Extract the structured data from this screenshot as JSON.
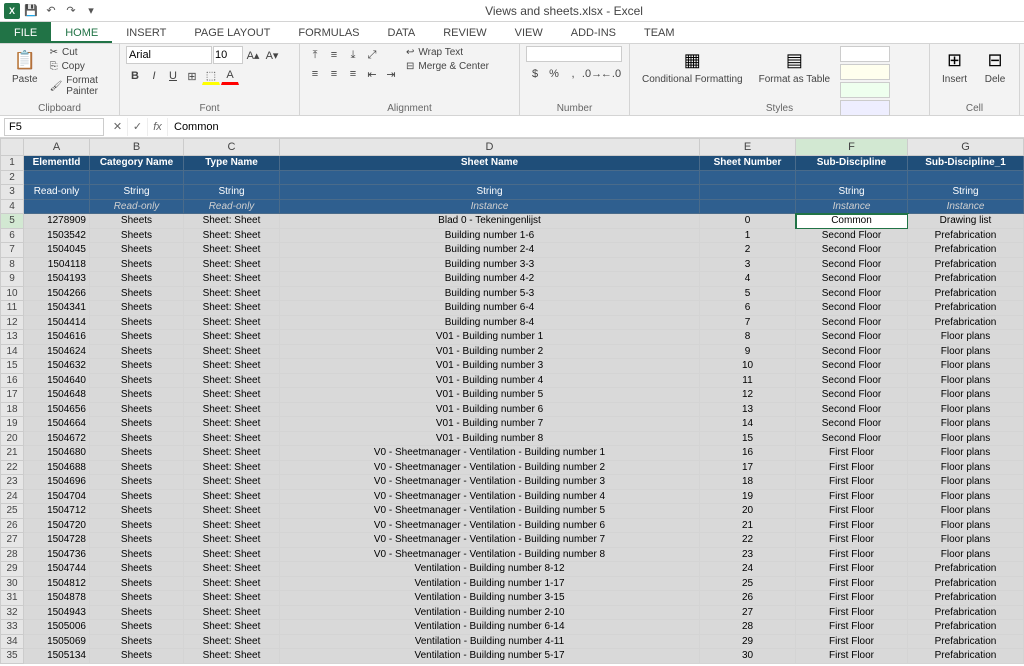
{
  "title": "Views and sheets.xlsx - Excel",
  "tabs": [
    "FILE",
    "HOME",
    "INSERT",
    "PAGE LAYOUT",
    "FORMULAS",
    "DATA",
    "REVIEW",
    "VIEW",
    "ADD-INS",
    "TEAM"
  ],
  "ribbon": {
    "clipboard": {
      "paste": "Paste",
      "cut": "Cut",
      "copy": "Copy",
      "fmt": "Format Painter",
      "label": "Clipboard"
    },
    "font": {
      "name": "Arial",
      "size": "10",
      "label": "Font"
    },
    "alignment": {
      "wrap": "Wrap Text",
      "merge": "Merge & Center",
      "label": "Alignment"
    },
    "number": {
      "label": "Number"
    },
    "styles": {
      "cond": "Conditional Formatting",
      "table": "Format as Table",
      "label": "Styles"
    },
    "cells": {
      "insert": "Insert",
      "delete": "Dele",
      "label": "Cell"
    }
  },
  "namebox": "F5",
  "formula": "Common",
  "columns": [
    "A",
    "B",
    "C",
    "D",
    "E",
    "F",
    "G"
  ],
  "headers": {
    "r1": [
      "ElementId",
      "Category Name",
      "Type Name",
      "Sheet Name",
      "Sheet Number",
      "Sub-Discipline",
      "Sub-Discipline_1"
    ],
    "r2": [
      "Read-only",
      "String",
      "String",
      "String",
      "",
      "String",
      "String"
    ],
    "r3": [
      "",
      "Read-only",
      "Read-only",
      "Instance",
      "",
      "Instance",
      "Instance"
    ]
  },
  "rows": [
    {
      "n": 5,
      "d": [
        "1278909",
        "Sheets",
        "Sheet: Sheet",
        "Blad 0 - Tekeningenlijst",
        "0",
        "Common",
        "Drawing list"
      ]
    },
    {
      "n": 6,
      "d": [
        "1503542",
        "Sheets",
        "Sheet: Sheet",
        "Building number 1-6",
        "1",
        "Second Floor",
        "Prefabrication"
      ]
    },
    {
      "n": 7,
      "d": [
        "1504045",
        "Sheets",
        "Sheet: Sheet",
        "Building number 2-4",
        "2",
        "Second Floor",
        "Prefabrication"
      ]
    },
    {
      "n": 8,
      "d": [
        "1504118",
        "Sheets",
        "Sheet: Sheet",
        "Building number 3-3",
        "3",
        "Second Floor",
        "Prefabrication"
      ]
    },
    {
      "n": 9,
      "d": [
        "1504193",
        "Sheets",
        "Sheet: Sheet",
        "Building number 4-2",
        "4",
        "Second Floor",
        "Prefabrication"
      ]
    },
    {
      "n": 10,
      "d": [
        "1504266",
        "Sheets",
        "Sheet: Sheet",
        "Building number 5-3",
        "5",
        "Second Floor",
        "Prefabrication"
      ]
    },
    {
      "n": 11,
      "d": [
        "1504341",
        "Sheets",
        "Sheet: Sheet",
        "Building number 6-4",
        "6",
        "Second Floor",
        "Prefabrication"
      ]
    },
    {
      "n": 12,
      "d": [
        "1504414",
        "Sheets",
        "Sheet: Sheet",
        "Building number 8-4",
        "7",
        "Second Floor",
        "Prefabrication"
      ]
    },
    {
      "n": 13,
      "d": [
        "1504616",
        "Sheets",
        "Sheet: Sheet",
        "V01 - Building number 1",
        "8",
        "Second Floor",
        "Floor plans"
      ]
    },
    {
      "n": 14,
      "d": [
        "1504624",
        "Sheets",
        "Sheet: Sheet",
        "V01 - Building number 2",
        "9",
        "Second Floor",
        "Floor plans"
      ]
    },
    {
      "n": 15,
      "d": [
        "1504632",
        "Sheets",
        "Sheet: Sheet",
        "V01 - Building number 3",
        "10",
        "Second Floor",
        "Floor plans"
      ]
    },
    {
      "n": 16,
      "d": [
        "1504640",
        "Sheets",
        "Sheet: Sheet",
        "V01 - Building number 4",
        "11",
        "Second Floor",
        "Floor plans"
      ]
    },
    {
      "n": 17,
      "d": [
        "1504648",
        "Sheets",
        "Sheet: Sheet",
        "V01 - Building number 5",
        "12",
        "Second Floor",
        "Floor plans"
      ]
    },
    {
      "n": 18,
      "d": [
        "1504656",
        "Sheets",
        "Sheet: Sheet",
        "V01 - Building number 6",
        "13",
        "Second Floor",
        "Floor plans"
      ]
    },
    {
      "n": 19,
      "d": [
        "1504664",
        "Sheets",
        "Sheet: Sheet",
        "V01 - Building number 7",
        "14",
        "Second Floor",
        "Floor plans"
      ]
    },
    {
      "n": 20,
      "d": [
        "1504672",
        "Sheets",
        "Sheet: Sheet",
        "V01 - Building number 8",
        "15",
        "Second Floor",
        "Floor plans"
      ]
    },
    {
      "n": 21,
      "d": [
        "1504680",
        "Sheets",
        "Sheet: Sheet",
        "V0 - Sheetmanager - Ventilation - Building number 1",
        "16",
        "First Floor",
        "Floor plans"
      ]
    },
    {
      "n": 22,
      "d": [
        "1504688",
        "Sheets",
        "Sheet: Sheet",
        "V0 - Sheetmanager - Ventilation - Building number 2",
        "17",
        "First Floor",
        "Floor plans"
      ]
    },
    {
      "n": 23,
      "d": [
        "1504696",
        "Sheets",
        "Sheet: Sheet",
        "V0 - Sheetmanager - Ventilation - Building number 3",
        "18",
        "First Floor",
        "Floor plans"
      ]
    },
    {
      "n": 24,
      "d": [
        "1504704",
        "Sheets",
        "Sheet: Sheet",
        "V0 - Sheetmanager - Ventilation - Building number 4",
        "19",
        "First Floor",
        "Floor plans"
      ]
    },
    {
      "n": 25,
      "d": [
        "1504712",
        "Sheets",
        "Sheet: Sheet",
        "V0 - Sheetmanager - Ventilation - Building number 5",
        "20",
        "First Floor",
        "Floor plans"
      ]
    },
    {
      "n": 26,
      "d": [
        "1504720",
        "Sheets",
        "Sheet: Sheet",
        "V0 - Sheetmanager - Ventilation - Building number 6",
        "21",
        "First Floor",
        "Floor plans"
      ]
    },
    {
      "n": 27,
      "d": [
        "1504728",
        "Sheets",
        "Sheet: Sheet",
        "V0 - Sheetmanager - Ventilation - Building number 7",
        "22",
        "First Floor",
        "Floor plans"
      ]
    },
    {
      "n": 28,
      "d": [
        "1504736",
        "Sheets",
        "Sheet: Sheet",
        "V0 - Sheetmanager - Ventilation - Building number 8",
        "23",
        "First Floor",
        "Floor plans"
      ]
    },
    {
      "n": 29,
      "d": [
        "1504744",
        "Sheets",
        "Sheet: Sheet",
        "Ventilation - Building number 8-12",
        "24",
        "First Floor",
        "Prefabrication"
      ]
    },
    {
      "n": 30,
      "d": [
        "1504812",
        "Sheets",
        "Sheet: Sheet",
        "Ventilation - Building number 1-17",
        "25",
        "First Floor",
        "Prefabrication"
      ]
    },
    {
      "n": 31,
      "d": [
        "1504878",
        "Sheets",
        "Sheet: Sheet",
        "Ventilation - Building number 3-15",
        "26",
        "First Floor",
        "Prefabrication"
      ]
    },
    {
      "n": 32,
      "d": [
        "1504943",
        "Sheets",
        "Sheet: Sheet",
        "Ventilation - Building number 2-10",
        "27",
        "First Floor",
        "Prefabrication"
      ]
    },
    {
      "n": 33,
      "d": [
        "1505006",
        "Sheets",
        "Sheet: Sheet",
        "Ventilation - Building number 6-14",
        "28",
        "First Floor",
        "Prefabrication"
      ]
    },
    {
      "n": 34,
      "d": [
        "1505069",
        "Sheets",
        "Sheet: Sheet",
        "Ventilation - Building number 4-11",
        "29",
        "First Floor",
        "Prefabrication"
      ]
    },
    {
      "n": 35,
      "d": [
        "1505134",
        "Sheets",
        "Sheet: Sheet",
        "Ventilation - Building number 5-17",
        "30",
        "First Floor",
        "Prefabrication"
      ]
    }
  ]
}
